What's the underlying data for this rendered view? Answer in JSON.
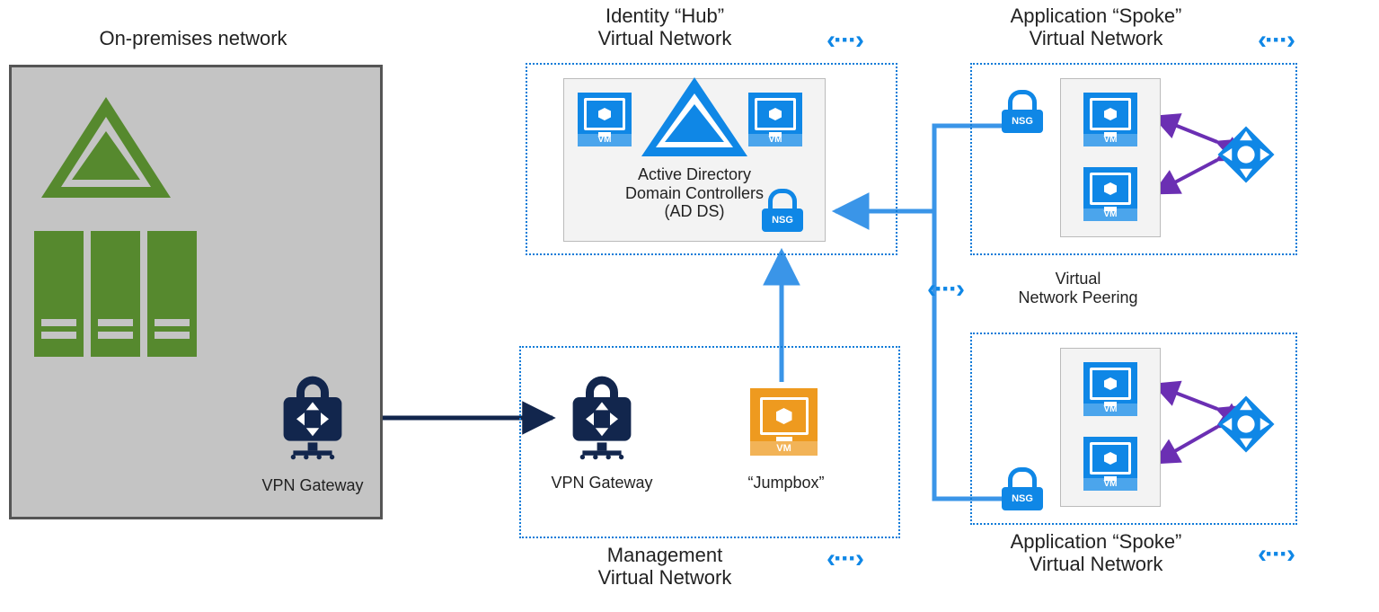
{
  "onprem": {
    "title": "On-premises network",
    "gateway_label": "VPN Gateway"
  },
  "hub": {
    "title_line1": "Identity “Hub”",
    "title_line2": "Virtual Network",
    "adds_line1": "Active Directory",
    "adds_line2": "Domain Controllers",
    "adds_line3": "(AD DS)",
    "nsg": "NSG",
    "vm_tag": "VM"
  },
  "mgmt": {
    "title_line1": "Management",
    "title_line2": "Virtual Network",
    "gateway_label": "VPN Gateway",
    "jumpbox_label": "“Jumpbox”",
    "vm_tag": "VM"
  },
  "spoke_top": {
    "title_line1": "Application “Spoke”",
    "title_line2": "Virtual Network",
    "nsg": "NSG",
    "vm_tag": "VM"
  },
  "spoke_bottom": {
    "title_line1": "Application “Spoke”",
    "title_line2": "Virtual Network",
    "nsg": "NSG",
    "vm_tag": "VM"
  },
  "peering": {
    "label_line1": "Virtual",
    "label_line2": "Network Peering"
  },
  "glyphs": {
    "peer": "‹···›"
  },
  "colors": {
    "azure_blue": "#0f87e6",
    "navy": "#12264d",
    "green": "#56892e",
    "orange": "#ee9a1f",
    "purple": "#6b2fb3"
  }
}
